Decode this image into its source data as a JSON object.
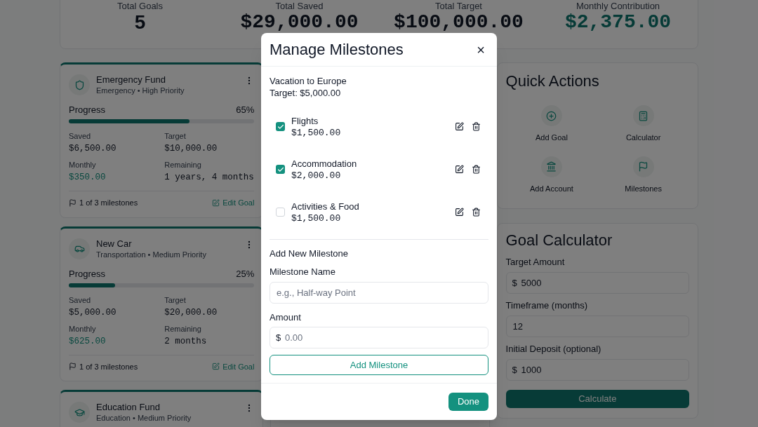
{
  "stats": [
    {
      "label": "Total Goals",
      "value": "5",
      "kind": "count"
    },
    {
      "label": "Total Saved",
      "value": "$29,000.00",
      "kind": "money"
    },
    {
      "label": "Total Target",
      "value": "$100,000.00",
      "kind": "money"
    },
    {
      "label": "Monthly Contribution",
      "value": "$2,375.00",
      "kind": "highlight"
    }
  ],
  "goals": [
    {
      "name": "Emergency Fund",
      "category": "Emergency • High Priority",
      "progress_label": "Progress",
      "percent": "65%",
      "level": 0.65,
      "fields": [
        {
          "label": "Saved",
          "value": "$6,500.00",
          "kind": "plain"
        },
        {
          "label": "Target",
          "value": "$10,000.00",
          "kind": "plain"
        },
        {
          "label": "Monthly",
          "value": "$350.00",
          "kind": "highlight"
        },
        {
          "label": "Remaining",
          "value": "1 years, 4 months",
          "kind": "plain"
        }
      ],
      "milestones": "1 of 3 milestones",
      "edit": "Edit Goal"
    },
    {
      "name": "New Car",
      "category": "Transportation • Medium Priority",
      "progress_label": "Progress",
      "percent": "25%",
      "level": 0.25,
      "fields": [
        {
          "label": "Saved",
          "value": "$5,000.00",
          "kind": "plain"
        },
        {
          "label": "Target",
          "value": "$20,000.00",
          "kind": "plain"
        },
        {
          "label": "Monthly",
          "value": "$625.00",
          "kind": "highlight"
        },
        {
          "label": "Remaining",
          "value": "2 months",
          "kind": "plain"
        }
      ],
      "milestones": "1 of 3 milestones",
      "edit": "Edit Goal"
    },
    {
      "name": "Education Fund",
      "category": "Education • Medium Priority"
    }
  ],
  "quick_actions": {
    "title": "Quick Actions",
    "items": [
      {
        "label": "Add Goal"
      },
      {
        "label": "Calculator"
      },
      {
        "label": "Add Account"
      },
      {
        "label": "Milestones"
      }
    ]
  },
  "calculator": {
    "title": "Goal Calculator",
    "fields": [
      {
        "label": "Target Amount",
        "prefix": "$",
        "value": "5000"
      },
      {
        "label": "Timeframe (months)",
        "value": "12"
      },
      {
        "label": "Initial Deposit (optional)",
        "prefix": "$",
        "value": "1000"
      }
    ],
    "button": "Calculate"
  },
  "dialog": {
    "title": "Manage Milestones",
    "close": "×",
    "goal_name": "Vacation to Europe",
    "goal_target": "Target: $5,000.00",
    "milestones": [
      {
        "name": "Flights",
        "amount": "$1,500.00",
        "checked": true
      },
      {
        "name": "Accommodation",
        "amount": "$2,000.00",
        "checked": true
      },
      {
        "name": "Activities & Food",
        "amount": "$1,500.00",
        "checked": false
      }
    ],
    "add_title": "Add New Milestone",
    "name_label": "Milestone Name",
    "name_placeholder": "e.g., Half-way Point",
    "amount_label": "Amount",
    "amount_prefix": "$",
    "amount_placeholder": "0.00",
    "add_button": "Add Milestone",
    "done_button": "Done"
  }
}
